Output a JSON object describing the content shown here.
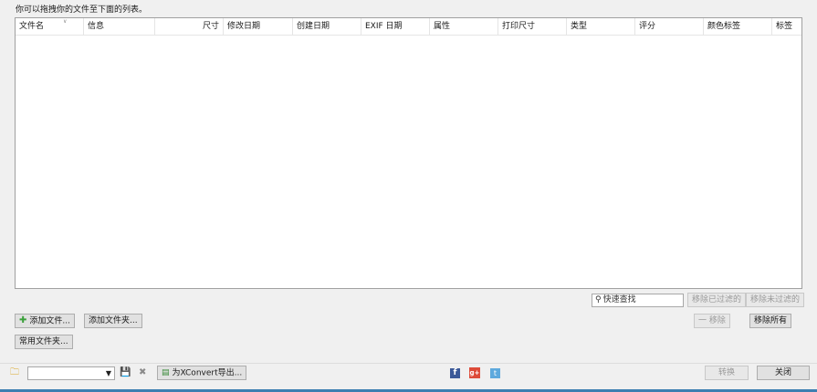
{
  "hint_text": "你可以拖拽你的文件至下面的列表。",
  "columns": {
    "filename": "文件名",
    "info": "信息",
    "size": "尺寸",
    "modified": "修改日期",
    "created": "创建日期",
    "exif_date": "EXIF 日期",
    "attributes": "属性",
    "print_size": "打印尺寸",
    "type": "类型",
    "rating": "评分",
    "color_label": "颜色标签",
    "tags": "标签"
  },
  "search": {
    "placeholder": "快速查找"
  },
  "buttons": {
    "remove_filtered": "移除已过滤的",
    "remove_unfiltered": "移除未过滤的",
    "add_files": "添加文件...",
    "add_folder": "添加文件夹...",
    "remove": "一 移除",
    "remove_all": "移除所有",
    "favorite_folders": "常用文件夹...",
    "export_xconvert": "为XConvert导出...",
    "convert": "转换",
    "close": "关闭"
  },
  "icons": {
    "folder": "folder-icon",
    "save": "save-icon",
    "delete": "delete-icon",
    "export": "export-icon",
    "facebook": "facebook-icon",
    "googleplus": "googleplus-icon",
    "twitter": "twitter-icon",
    "add": "add-icon"
  },
  "social": {
    "facebook": "f",
    "googleplus": "g+",
    "twitter": "t"
  },
  "colors": {
    "accent": "#3c7fb1",
    "add_icon": "#3aa03a",
    "facebook": "#3b5998",
    "googleplus": "#dd4b39",
    "twitter": "#5ea9dd"
  }
}
